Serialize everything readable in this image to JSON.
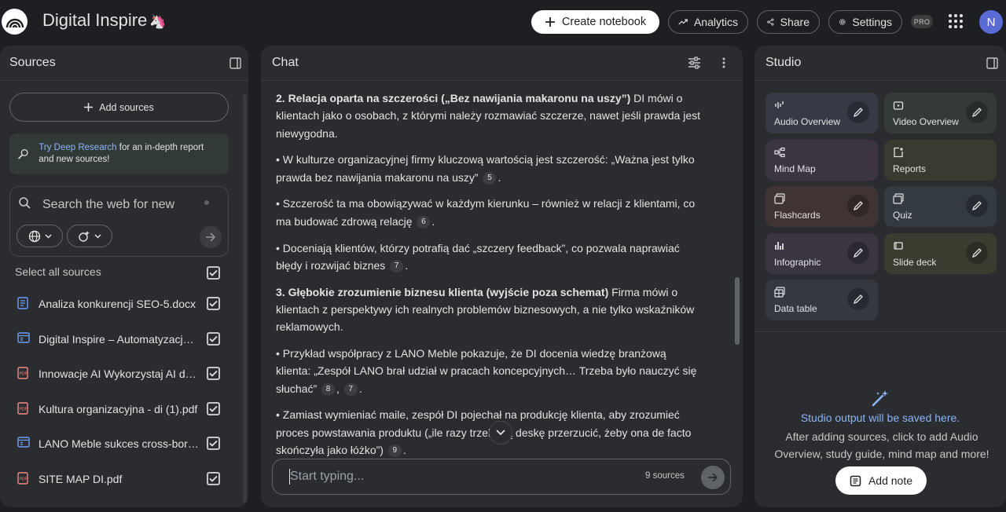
{
  "header": {
    "app_title": "Digital Inspire",
    "create_label": "Create notebook",
    "analytics_label": "Analytics",
    "share_label": "Share",
    "settings_label": "Settings",
    "pro_badge": "PRO",
    "avatar_letter": "N"
  },
  "sources": {
    "title": "Sources",
    "add_label": "Add sources",
    "deep_research_link": "Try Deep Research",
    "deep_research_rest": " for an in-depth report and new sources!",
    "search_placeholder": "Search the web for new",
    "select_all_label": "Select all sources",
    "items": [
      {
        "name": "Analiza konkurencji SEO-5.docx",
        "type": "doc-icon"
      },
      {
        "name": "Digital Inspire – Automatyzacja i Konsulting",
        "type": "web-icon"
      },
      {
        "name": "Innowacje AI Wykorzystaj AI do automatyzacji",
        "type": "pdf-icon"
      },
      {
        "name": "Kultura organizacyjna - di (1).pdf",
        "type": "pdf-icon"
      },
      {
        "name": "LANO Meble sukces cross-border",
        "type": "web-icon"
      },
      {
        "name": "SITE MAP DI.pdf",
        "type": "pdf-icon"
      }
    ]
  },
  "chat": {
    "title": "Chat",
    "p1_bold": "2. Relacja oparta na szczerości („Bez nawijania makaronu na uszy”)",
    "p1_rest": " DI mówi o klientach jako o osobach, z którymi należy rozmawiać szczerze, nawet jeśli prawda jest niewygodna.",
    "p2": "• W kulturze organizacyjnej firmy kluczową wartością jest szczerość: „Ważna jest tylko prawda bez nawijania makaronu na uszy”",
    "p2_cite": "5",
    "p3": "• Szczerość ta ma obowiązywać w każdym kierunku – również w relacji z klientami, co ma budować zdrową relację",
    "p3_cite": "6",
    "p4": "• Doceniają klientów, którzy potrafią dać „szczery feedback”, co pozwala naprawiać błędy i rozwijać biznes",
    "p4_cite": "7",
    "p5_bold": "3. Głębokie zrozumienie biznesu klienta (wyjście poza schemat)",
    "p5_rest": " Firma mówi o klientach z perspektywy ich realnych problemów biznesowych, a nie tylko wskaźników reklamowych.",
    "p6": "• Przykład współpracy z LANO Meble pokazuje, że DI docenia wiedzę branżową klienta: „Zespół LANO brał udział w pracach koncepcyjnych… Trzeba było nauczyć się słuchać”",
    "p6_cite_a": "8",
    "p6_cite_b": "7",
    "p7": "• Zamiast wymieniać maile, zespół DI pojechał na produkcję klienta, aby zrozumieć proces powstawania produktu („ile razy trzeba tą deskę przerzucić, żeby ona de facto skończyła jako łóżko”)",
    "p7_cite": "9",
    "input_placeholder": "Start typing...",
    "source_count": "9 sources"
  },
  "studio": {
    "title": "Studio",
    "tiles": [
      {
        "label": "Audio Overview",
        "icon": "audio-waveform-icon",
        "bg": "#353a45"
      },
      {
        "label": "Video Overview",
        "icon": "video-icon",
        "bg": "#343b37"
      },
      {
        "label": "Mind Map",
        "icon": "mind-map-icon",
        "bg": "#3c3440"
      },
      {
        "label": "Reports",
        "icon": "reports-icon",
        "bg": "#3b3a30"
      },
      {
        "label": "Flashcards",
        "icon": "flashcards-icon",
        "bg": "#3f3433"
      },
      {
        "label": "Quiz",
        "icon": "quiz-icon",
        "bg": "#343a42"
      },
      {
        "label": "Infographic",
        "icon": "infographic-icon",
        "bg": "#3a3540"
      },
      {
        "label": "Slide deck",
        "icon": "slide-deck-icon",
        "bg": "#3b3b30"
      },
      {
        "label": "Data table",
        "icon": "data-table-icon",
        "bg": "#353840"
      }
    ],
    "empty_title": "Studio output will be saved here.",
    "empty_desc": "After adding sources, click to add Audio Overview, study guide, mind map and more!",
    "add_note_label": "Add note"
  }
}
